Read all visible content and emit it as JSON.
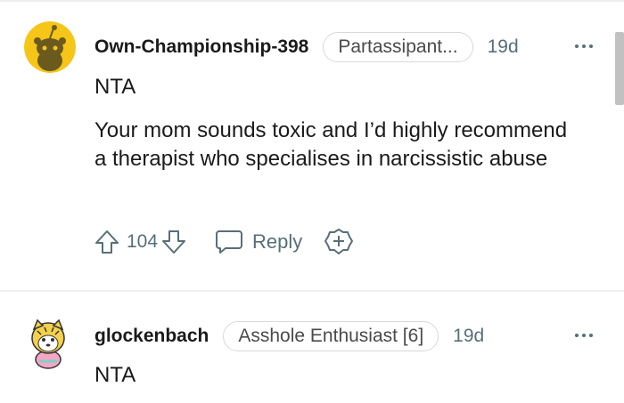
{
  "comments": [
    {
      "username": "Own-Championship-398",
      "flair": "Partassipant...",
      "timestamp": "19d",
      "verdict": "NTA",
      "body": "Your mom sounds toxic and I’d highly recommend a therapist who specialises in narcissistic abuse",
      "vote_count": "104",
      "reply_label": "Reply",
      "avatar": "snoo-avatar-yellow"
    },
    {
      "username": "glockenbach",
      "flair": "Asshole Enthusiast [6]",
      "timestamp": "19d",
      "verdict": "NTA",
      "avatar": "cartoon-avatar"
    }
  ],
  "icons": {
    "upvote": "upvote-arrow-icon",
    "downvote": "downvote-arrow-icon",
    "reply": "speech-bubble-icon",
    "award": "award-icon",
    "more": "more-options-icon"
  },
  "colors": {
    "text": "#1a1a1b",
    "meta": "#576f76",
    "avatar_yellow": "#f5c518",
    "divider": "#edeff1"
  }
}
